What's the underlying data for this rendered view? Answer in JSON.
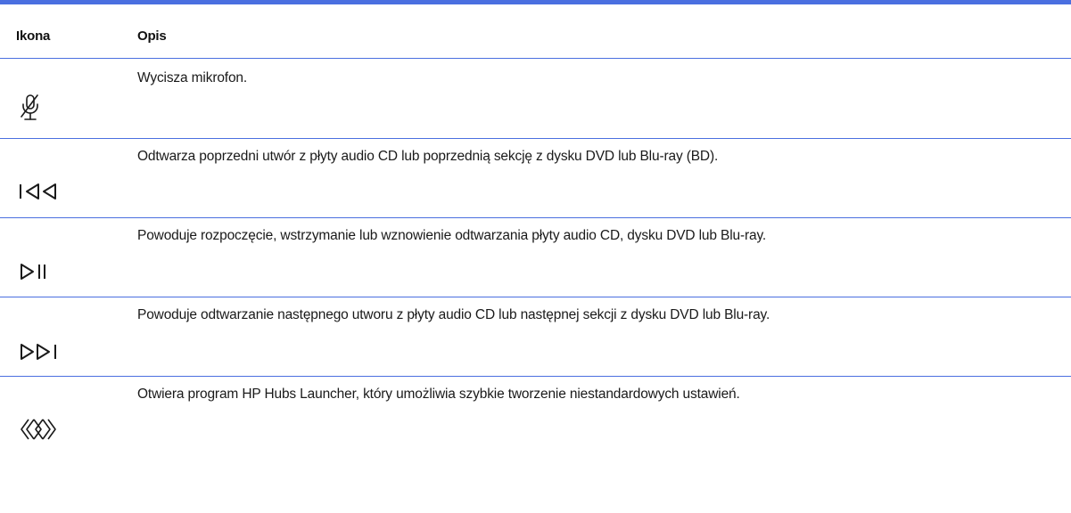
{
  "table": {
    "headers": {
      "icon": "Ikona",
      "description": "Opis"
    },
    "rows": [
      {
        "icon": "microphone-mute-icon",
        "description": "Wycisza mikrofon."
      },
      {
        "icon": "previous-track-icon",
        "description": "Odtwarza poprzedni utwór z płyty audio CD lub poprzednią sekcję z dysku DVD lub Blu-ray (BD)."
      },
      {
        "icon": "play-pause-icon",
        "description": "Powoduje rozpoczęcie, wstrzymanie lub wznowienie odtwarzania płyty audio CD, dysku DVD lub Blu-ray."
      },
      {
        "icon": "next-track-icon",
        "description": "Powoduje odtwarzanie następnego utworu z płyty audio CD lub następnej sekcji z dysku DVD lub Blu-ray."
      },
      {
        "icon": "hp-hubs-launcher-icon",
        "description": "Otwiera program HP Hubs Launcher, który umożliwia szybkie tworzenie niestandardowych ustawień."
      }
    ]
  },
  "colors": {
    "rule": "#4a6fe0",
    "text": "#1a1a1a"
  }
}
